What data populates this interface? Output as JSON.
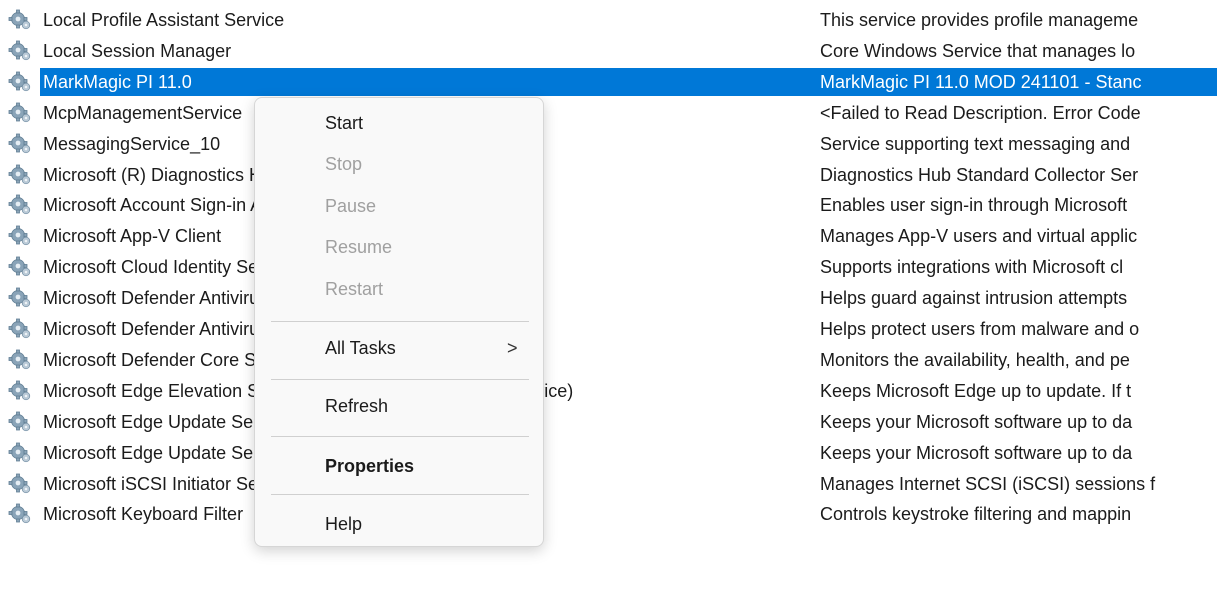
{
  "services": [
    {
      "name": "Local Profile Assistant Service",
      "desc": "This service provides profile manageme"
    },
    {
      "name": "Local Session Manager",
      "desc": "Core Windows Service that manages lo"
    },
    {
      "name": "MarkMagic PI 11.0",
      "desc": "MarkMagic PI 11.0 MOD 241101 - Stanc",
      "selected": true
    },
    {
      "name": "McpManagementService",
      "desc": "<Failed to Read Description. Error Code"
    },
    {
      "name": "MessagingService_10",
      "desc": "Service supporting text messaging and"
    },
    {
      "name": "Microsoft (R) Diagnostics Hub Standard Collector Service",
      "desc": "Diagnostics Hub Standard Collector Ser"
    },
    {
      "name": "Microsoft Account Sign-in Assistant",
      "desc": "Enables user sign-in through Microsoft"
    },
    {
      "name": "Microsoft App-V Client",
      "desc": "Manages App-V users and virtual applic"
    },
    {
      "name": "Microsoft Cloud Identity Service",
      "desc": "Supports integrations with Microsoft cl"
    },
    {
      "name": "Microsoft Defender Antivirus Network Inspection Service",
      "desc": "Helps guard against intrusion attempts"
    },
    {
      "name": "Microsoft Defender Antivirus Service",
      "desc": "Helps protect users from malware and o"
    },
    {
      "name": "Microsoft Defender Core Service",
      "desc": "Monitors the availability, health, and pe"
    },
    {
      "name": "Microsoft Edge Elevation Service (MicrosoftEdgeElevationService)",
      "desc": "Keeps Microsoft Edge up to update. If t"
    },
    {
      "name": "Microsoft Edge Update Service (edgeupdate)",
      "desc": "Keeps your Microsoft software up to da"
    },
    {
      "name": "Microsoft Edge Update Service (edgeupdatem)",
      "desc": "Keeps your Microsoft software up to da"
    },
    {
      "name": "Microsoft iSCSI Initiator Service",
      "desc": "Manages Internet SCSI (iSCSI) sessions f"
    },
    {
      "name": "Microsoft Keyboard Filter",
      "desc": "Controls keystroke filtering and mappin"
    }
  ],
  "context_menu": {
    "start": "Start",
    "stop": "Stop",
    "pause": "Pause",
    "resume": "Resume",
    "restart": "Restart",
    "all_tasks": "All Tasks",
    "submenu_arrow": ">",
    "refresh": "Refresh",
    "properties": "Properties",
    "help": "Help"
  },
  "colors": {
    "selection": "#0078d7",
    "menu_background": "#f9f9f9",
    "disabled_text": "#a0a0a0"
  },
  "icons": {
    "service": "gear-icon"
  }
}
